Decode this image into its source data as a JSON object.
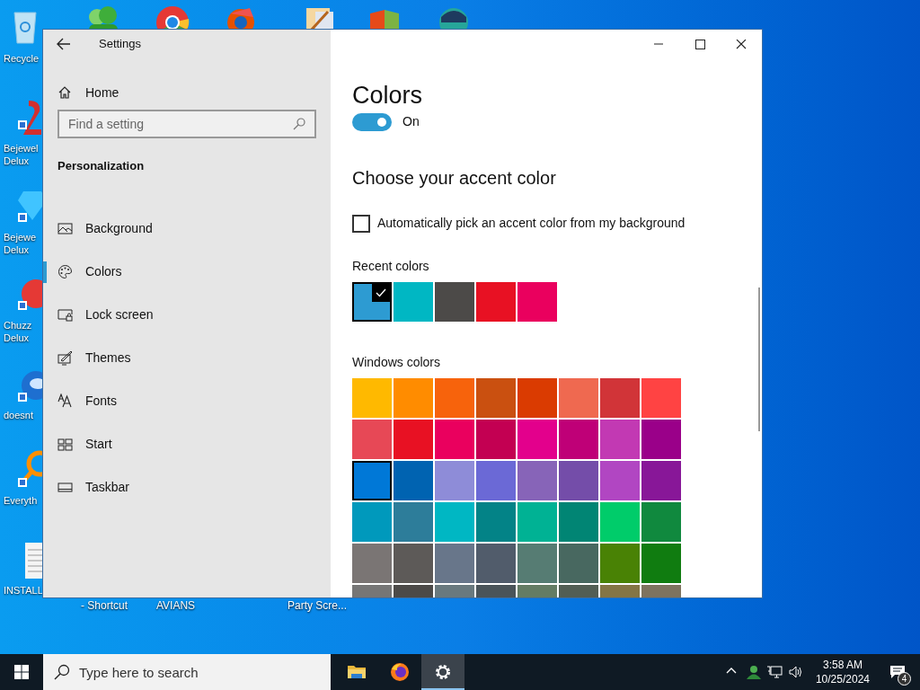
{
  "desktop": {
    "left_icons": [
      {
        "label_lines": [
          "Recycle"
        ]
      },
      {
        "label_lines": [
          "Bejewel",
          "Delux"
        ]
      },
      {
        "label_lines": [
          "Bejewe",
          "Delux"
        ]
      },
      {
        "label_lines": [
          "Chuzz",
          "Delux"
        ]
      },
      {
        "label_lines": [
          "doesnt"
        ]
      },
      {
        "label_lines": [
          "Everyth"
        ]
      },
      {
        "label_lines": [
          "INSTALL"
        ]
      }
    ],
    "bottom_labels": [
      "- Shortcut",
      "AVIANS",
      "Party Scre..."
    ]
  },
  "window": {
    "title": "Settings"
  },
  "sidebar": {
    "home": "Home",
    "search": {
      "placeholder": "Find a setting"
    },
    "section": "Personalization",
    "items": [
      {
        "label": "Background",
        "kind": "background",
        "selected": false
      },
      {
        "label": "Colors",
        "kind": "colors",
        "selected": true
      },
      {
        "label": "Lock screen",
        "kind": "lock",
        "selected": false
      },
      {
        "label": "Themes",
        "kind": "themes",
        "selected": false
      },
      {
        "label": "Fonts",
        "kind": "fonts",
        "selected": false
      },
      {
        "label": "Start",
        "kind": "start",
        "selected": false
      },
      {
        "label": "Taskbar",
        "kind": "taskbar",
        "selected": false
      }
    ]
  },
  "content": {
    "title": "Colors",
    "toggle": {
      "on": true,
      "label": "On"
    },
    "accent_heading": "Choose your accent color",
    "auto_pick": {
      "label": "Automatically pick an accent color from my background",
      "checked": false
    },
    "recent_label": "Recent colors",
    "recent_colors": [
      {
        "color": "#2d9bd2",
        "selected": true
      },
      {
        "color": "#00b7c3",
        "selected": false
      },
      {
        "color": "#4c4a48",
        "selected": false
      },
      {
        "color": "#e81123",
        "selected": false
      },
      {
        "color": "#ea005e",
        "selected": false
      }
    ],
    "windows_label": "Windows colors",
    "windows_colors": [
      {
        "color": "#ffb900",
        "selected": false
      },
      {
        "color": "#ff8c00",
        "selected": false
      },
      {
        "color": "#f7630c",
        "selected": false
      },
      {
        "color": "#ca5010",
        "selected": false
      },
      {
        "color": "#da3b01",
        "selected": false
      },
      {
        "color": "#ef6950",
        "selected": false
      },
      {
        "color": "#d13438",
        "selected": false
      },
      {
        "color": "#ff4343",
        "selected": false
      },
      {
        "color": "#e74856",
        "selected": false
      },
      {
        "color": "#e81123",
        "selected": false
      },
      {
        "color": "#ea005e",
        "selected": false
      },
      {
        "color": "#c30052",
        "selected": false
      },
      {
        "color": "#e3008c",
        "selected": false
      },
      {
        "color": "#bf0077",
        "selected": false
      },
      {
        "color": "#c239b3",
        "selected": false
      },
      {
        "color": "#9a0089",
        "selected": false
      },
      {
        "color": "#0078d7",
        "selected": true
      },
      {
        "color": "#0063b1",
        "selected": false
      },
      {
        "color": "#8e8cd8",
        "selected": false
      },
      {
        "color": "#6b69d6",
        "selected": false
      },
      {
        "color": "#8764b8",
        "selected": false
      },
      {
        "color": "#744da9",
        "selected": false
      },
      {
        "color": "#b146c2",
        "selected": false
      },
      {
        "color": "#881798",
        "selected": false
      },
      {
        "color": "#0099bc",
        "selected": false
      },
      {
        "color": "#2d7d9a",
        "selected": false
      },
      {
        "color": "#00b7c3",
        "selected": false
      },
      {
        "color": "#038387",
        "selected": false
      },
      {
        "color": "#00b294",
        "selected": false
      },
      {
        "color": "#018574",
        "selected": false
      },
      {
        "color": "#00cc6a",
        "selected": false
      },
      {
        "color": "#10893e",
        "selected": false
      },
      {
        "color": "#7a7574",
        "selected": false
      },
      {
        "color": "#5d5a58",
        "selected": false
      },
      {
        "color": "#68768a",
        "selected": false
      },
      {
        "color": "#515c6b",
        "selected": false
      },
      {
        "color": "#567c73",
        "selected": false
      },
      {
        "color": "#486860",
        "selected": false
      },
      {
        "color": "#498205",
        "selected": false
      },
      {
        "color": "#107c10",
        "selected": false
      },
      {
        "color": "#767676",
        "selected": false
      },
      {
        "color": "#4c4a48",
        "selected": false
      },
      {
        "color": "#69797e",
        "selected": false
      },
      {
        "color": "#4a5459",
        "selected": false
      },
      {
        "color": "#647c64",
        "selected": false
      },
      {
        "color": "#525e54",
        "selected": false
      },
      {
        "color": "#847545",
        "selected": false
      },
      {
        "color": "#7e735f",
        "selected": false
      }
    ]
  },
  "taskbar": {
    "search": {
      "placeholder": "Type here to search"
    },
    "apps": [
      {
        "kind": "folder",
        "selected": false
      },
      {
        "kind": "browser",
        "selected": false
      },
      {
        "kind": "settings",
        "selected": true
      }
    ],
    "time": "3:58 AM",
    "date": "10/25/2024",
    "notifications": "4"
  }
}
